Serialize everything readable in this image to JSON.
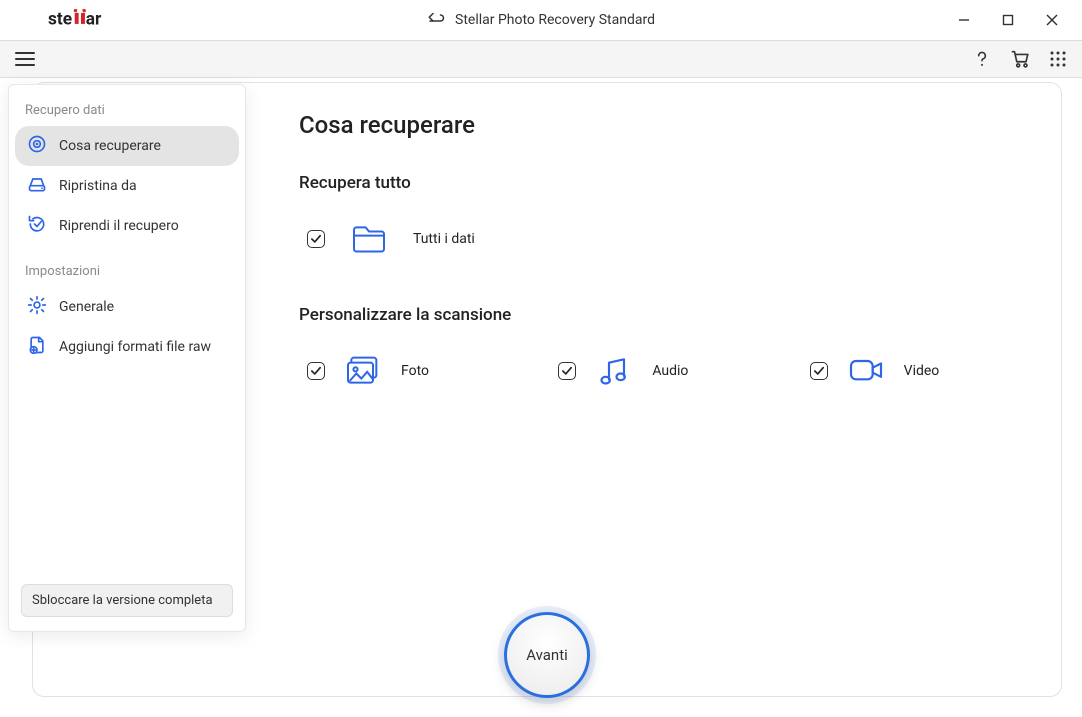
{
  "window": {
    "title": "Stellar Photo Recovery Standard",
    "brand": "stellar"
  },
  "sidebar": {
    "sections": {
      "recovery_label": "Recupero dati",
      "settings_label": "Impostazioni"
    },
    "items": {
      "what_recover": "Cosa recuperare",
      "recover_from": "Ripristina da",
      "resume": "Riprendi il recupero",
      "general": "Generale",
      "add_raw": "Aggiungi formati file raw"
    },
    "unlock_label": "Sbloccare la versione completa"
  },
  "main": {
    "title": "Cosa recuperare",
    "recover_all_label": "Recupera tutto",
    "all_data_label": "Tutti i dati",
    "customize_label": "Personalizzare la scansione",
    "photo_label": "Foto",
    "audio_label": "Audio",
    "video_label": "Video",
    "next_label": "Avanti"
  },
  "checkboxes": {
    "all_data": true,
    "photo": true,
    "audio": true,
    "video": true
  },
  "colors": {
    "accent": "#2a6fe0",
    "icon_blue": "#2e66e6"
  }
}
